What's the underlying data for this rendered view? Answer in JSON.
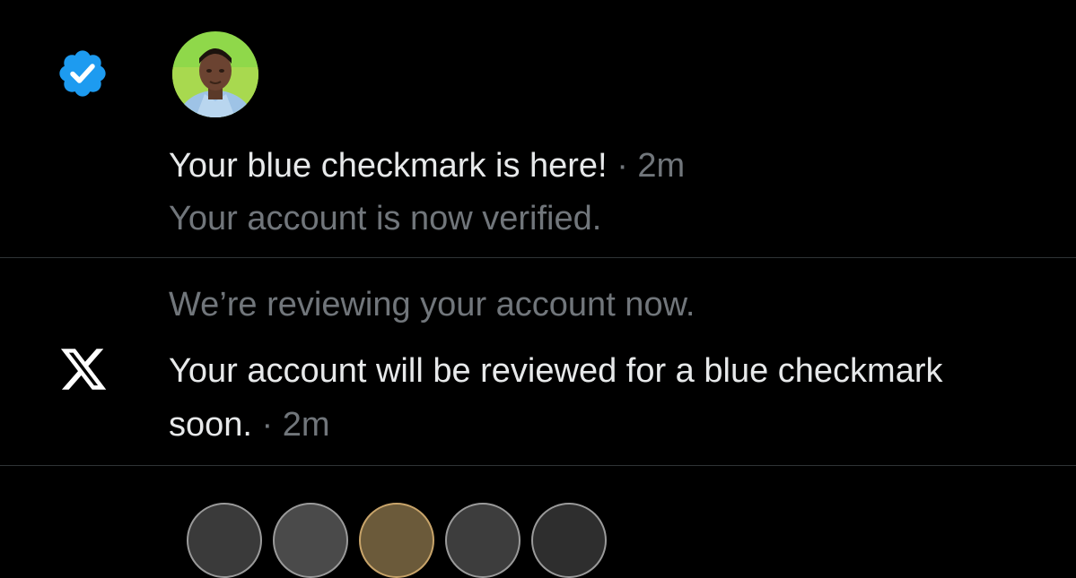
{
  "notifications": [
    {
      "icon": "verified-badge-icon",
      "icon_color": "#1d9bf0",
      "title": "Your blue checkmark is here!",
      "separator": "·",
      "time": "2m",
      "subtitle": "Your account is now verified."
    },
    {
      "icon": "x-logo-icon",
      "icon_color": "#ffffff",
      "subtitle": "We’re reviewing your account now.",
      "title": "Your account will be reviewed for a blue checkmark soon.",
      "separator": "·",
      "time": "2m"
    }
  ],
  "colors": {
    "background": "#000000",
    "primary_text": "#e7e9ea",
    "secondary_text": "#71767b",
    "divider": "#2f3336",
    "verified_blue": "#1d9bf0"
  }
}
